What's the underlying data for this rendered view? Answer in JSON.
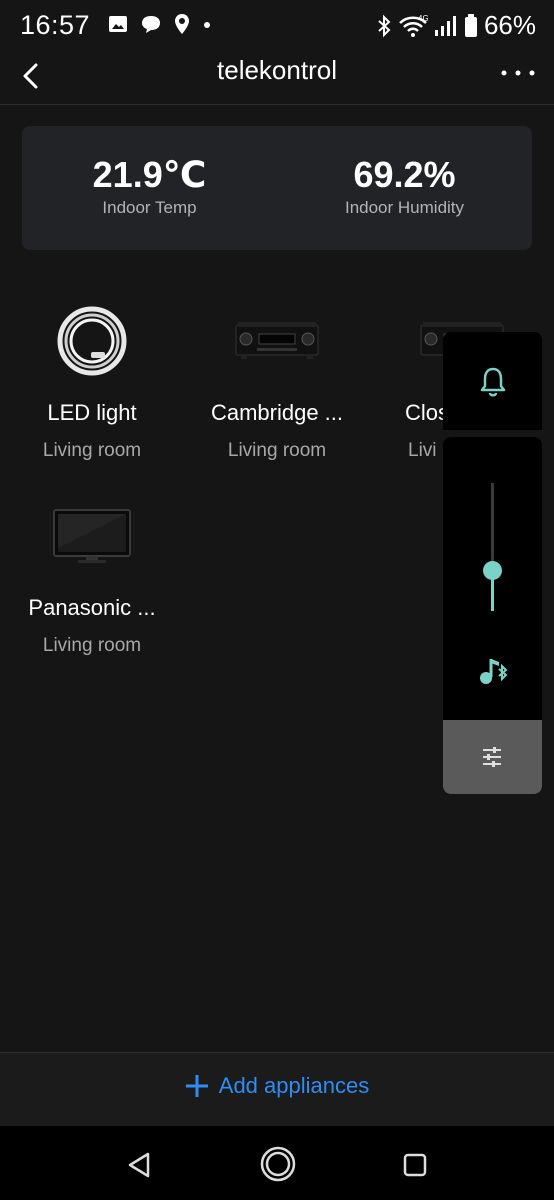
{
  "status_bar": {
    "time": "16:57",
    "battery": "66%",
    "network": "4G"
  },
  "header": {
    "title": "telekontrol"
  },
  "sensors": {
    "temp_value": "21.9℃",
    "temp_label": "Indoor Temp",
    "humidity_value": "69.2%",
    "humidity_label": "Indoor Humidity"
  },
  "devices": [
    {
      "name": "LED light",
      "room": "Living room",
      "icon": "led-strip-icon"
    },
    {
      "name": "Cambridge ...",
      "room": "Living room",
      "icon": "av-receiver-icon"
    },
    {
      "name": "Clos",
      "room": "Livi",
      "icon": "av-receiver-icon"
    },
    {
      "name": "Panasonic ...",
      "room": "Living room",
      "icon": "tv-icon"
    }
  ],
  "overlay": {
    "volume_level": 0.32,
    "accent": "#7bd3c8"
  },
  "footer": {
    "add_label": "Add appliances",
    "accent": "#2f8cf3"
  }
}
